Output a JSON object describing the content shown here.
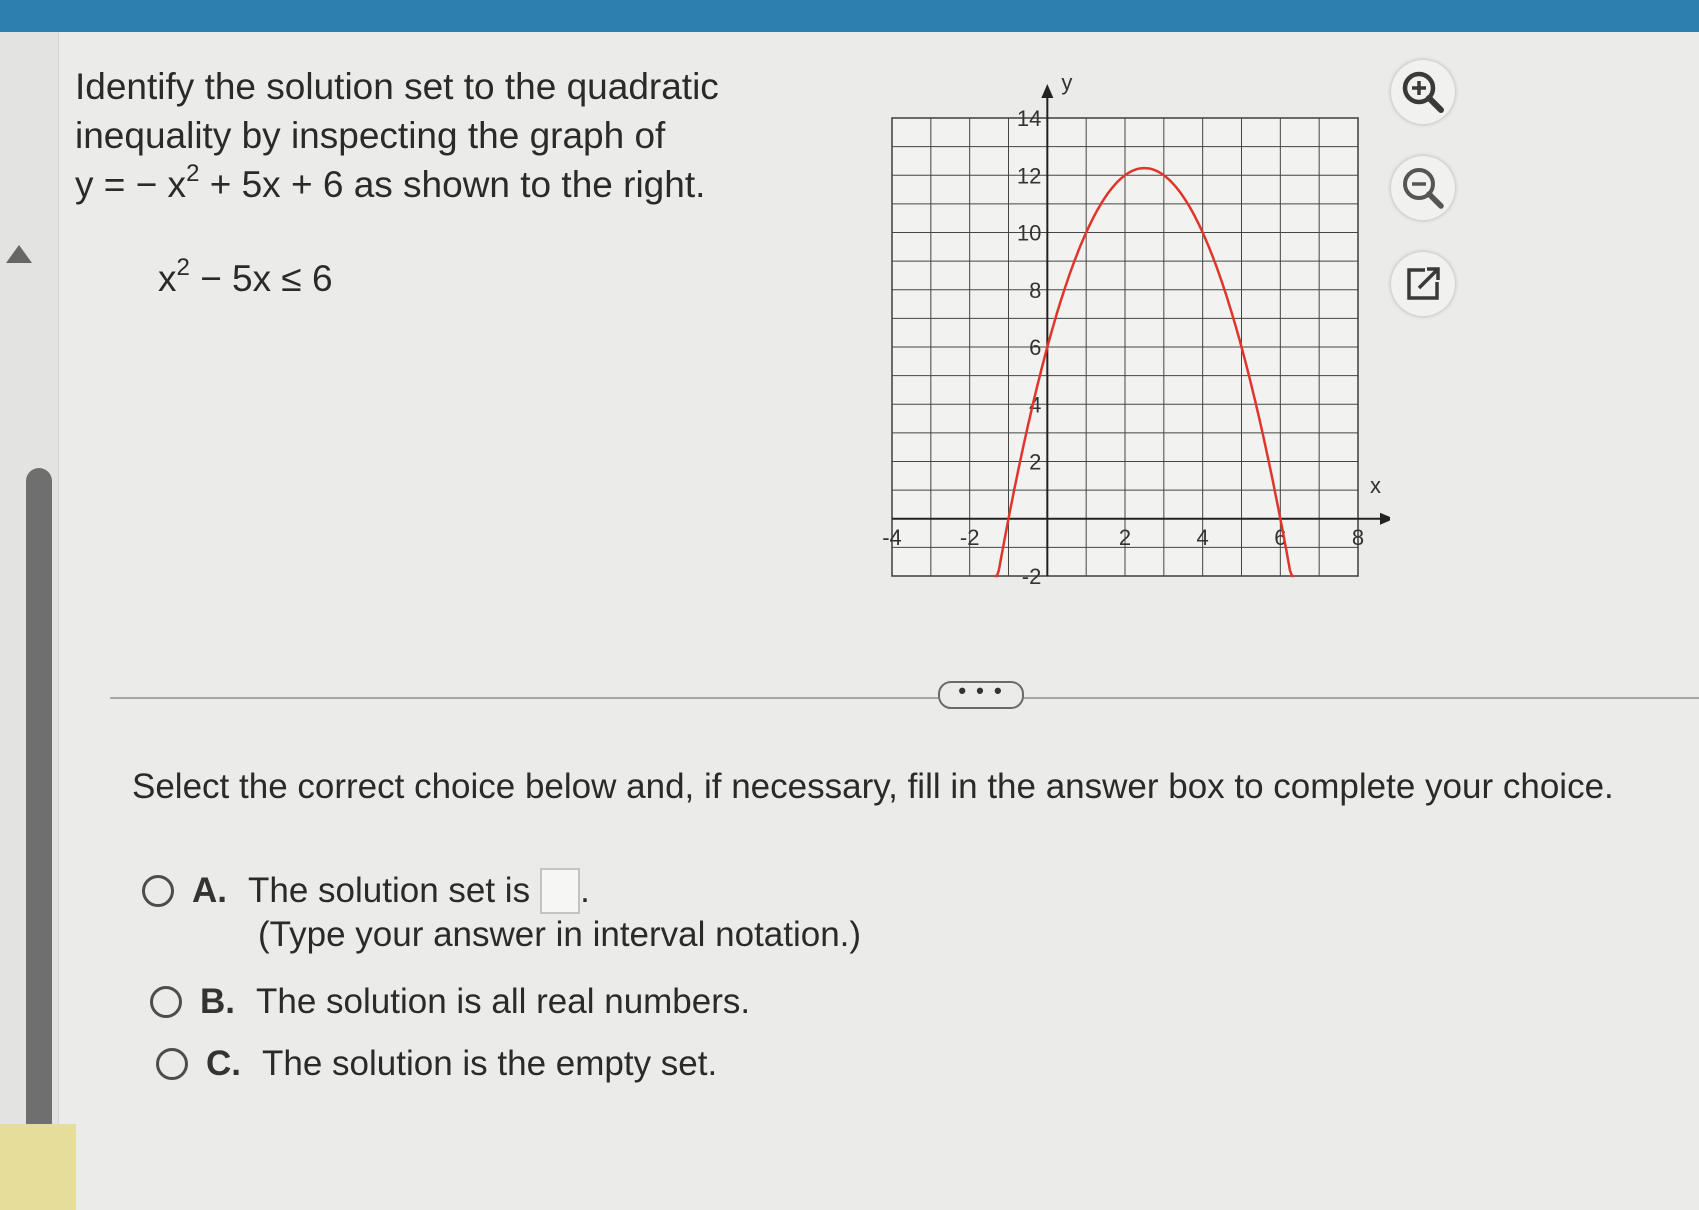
{
  "question": {
    "line1": "Identify the solution set to the quadratic",
    "line2": "inequality by inspecting the graph of",
    "equation_prefix": "y = − x",
    "equation_exp": "2",
    "equation_suffix": " + 5x + 6 as shown to the right.",
    "inequality_base": "x",
    "inequality_exp": "2",
    "inequality_rest": " − 5x ≤ 6"
  },
  "graph": {
    "x_label": "x",
    "y_label": "y",
    "x_ticks": [
      "-4",
      "-2",
      "2",
      "4",
      "6",
      "8"
    ],
    "y_ticks": [
      "14",
      "12",
      "10",
      "8",
      "6",
      "4",
      "2",
      "-2"
    ],
    "curve_color": "#e0352b"
  },
  "chart_data": {
    "type": "line",
    "function": "y = -x^2 + 5x + 6",
    "x_range": [
      -4,
      8
    ],
    "y_range": [
      -2,
      14
    ],
    "xlim": [
      -4,
      8
    ],
    "ylim": [
      -2,
      14
    ],
    "grid": true
  },
  "tools": {
    "zoom_in": "zoom-in-icon",
    "zoom_out": "zoom-out-icon",
    "popout": "popout-icon"
  },
  "more_label": "• • •",
  "instruction": "Select the correct choice below and, if necessary, fill in the answer box to complete your choice.",
  "choices": {
    "a": {
      "letter": "A.",
      "text": "The solution set is",
      "period": ".",
      "hint": "(Type your answer in interval notation.)"
    },
    "b": {
      "letter": "B.",
      "text": "The solution is all real numbers."
    },
    "c": {
      "letter": "C.",
      "text": "The solution is the empty set."
    }
  },
  "colors": {
    "top_bar": "#2d7fb0",
    "curve": "#e0352b",
    "scrollbar": "#6f6f6f"
  }
}
